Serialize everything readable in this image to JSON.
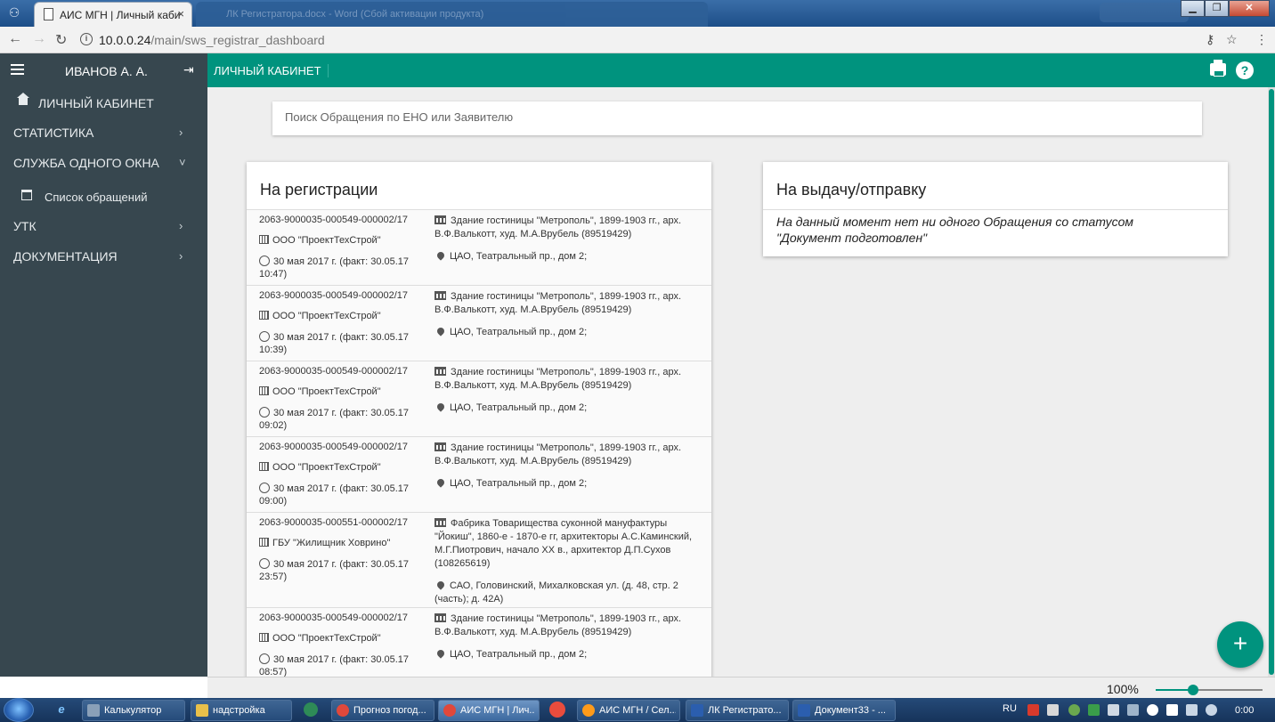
{
  "browser": {
    "active_tab_title": "АИС МГН | Личный каби",
    "tab_close": "×",
    "inactive_tab_title": "ЛК Регистратора.docx - Word (Сбой активации продукта)",
    "url_host": "10.0.0.24",
    "url_path": "/main/sws_registrar_dashboard",
    "info_icon": "i",
    "window_buttons": [
      "▁",
      "❐",
      "✕"
    ]
  },
  "header": {
    "username": "ИВАНОВ А. А.",
    "logout_icon": "⇥",
    "crumb": "ЛИЧНЫЙ КАБИНЕТ",
    "help_icon": "?",
    "accent": "#00937e",
    "sidebar_bg": "#37474f"
  },
  "sidebar": {
    "home": "ЛИЧНЫЙ КАБИНЕТ",
    "items": [
      {
        "label": "СТАТИСТИКА",
        "chevron": "›"
      },
      {
        "label": "СЛУЖБА ОДНОГО ОКНА",
        "chevron": "˅"
      },
      {
        "label": "УТК",
        "chevron": "›"
      },
      {
        "label": "ДОКУМЕНТАЦИЯ",
        "chevron": "›"
      }
    ],
    "sub_item": "Список обращений"
  },
  "search": {
    "placeholder": "Поиск Обращения по ЕНО или Заявителю"
  },
  "registration": {
    "title": "На регистрации",
    "rows": [
      {
        "eno": "2063-9000035-000549-000002/17",
        "org": "ООО \"ПроектТехСтрой\"",
        "date": "30 мая 2017 г. (факт: 30.05.17 10:47)",
        "object": "Здание гостиницы \"Метрополь\", 1899-1903 гг., арх. В.Ф.Валькотт, худ. М.А.Врубель (89519429)",
        "address": "ЦАО, Театральный пр., дом 2;"
      },
      {
        "eno": "2063-9000035-000549-000002/17",
        "org": "ООО \"ПроектТехСтрой\"",
        "date": "30 мая 2017 г. (факт: 30.05.17 10:39)",
        "object": "Здание гостиницы \"Метрополь\", 1899-1903 гг., арх. В.Ф.Валькотт, худ. М.А.Врубель (89519429)",
        "address": "ЦАО, Театральный пр., дом 2;"
      },
      {
        "eno": "2063-9000035-000549-000002/17",
        "org": "ООО \"ПроектТехСтрой\"",
        "date": "30 мая 2017 г. (факт: 30.05.17 09:02)",
        "object": "Здание гостиницы \"Метрополь\", 1899-1903 гг., арх. В.Ф.Валькотт, худ. М.А.Врубель (89519429)",
        "address": "ЦАО, Театральный пр., дом 2;"
      },
      {
        "eno": "2063-9000035-000549-000002/17",
        "org": "ООО \"ПроектТехСтрой\"",
        "date": "30 мая 2017 г. (факт: 30.05.17 09:00)",
        "object": "Здание гостиницы \"Метрополь\", 1899-1903 гг., арх. В.Ф.Валькотт, худ. М.А.Врубель (89519429)",
        "address": "ЦАО, Театральный пр., дом 2;"
      },
      {
        "eno": "2063-9000035-000551-000002/17",
        "org": "ГБУ \"Жилищник Ховрино\"",
        "date": "30 мая 2017 г. (факт: 30.05.17 23:57)",
        "object": "Фабрика Товарищества суконной мануфактуры \"Йокиш\", 1860-е - 1870-е гг, архитекторы А.С.Каминский, М.Г.Пиотрович, начало XX в., архитектор Д.П.Сухов (108265619)",
        "address": "САО, Головинский, Михалковская ул. (д. 48, стр. 2 (часть); д. 42А)"
      },
      {
        "eno": "2063-9000035-000549-000002/17",
        "org": "ООО \"ПроектТехСтрой\"",
        "date": "30 мая 2017 г. (факт: 30.05.17 08:57)",
        "object": "Здание гостиницы \"Метрополь\", 1899-1903 гг., арх. В.Ф.Валькотт, худ. М.А.Врубель (89519429)",
        "address": "ЦАО, Театральный пр., дом 2;"
      }
    ]
  },
  "outgoing": {
    "title": "На выдачу/отправку",
    "empty_message": "На данный момент нет ни одного Обращения со статусом \"Документ подготовлен\""
  },
  "fab_label": "+",
  "status": {
    "zoom": "100%",
    "zoom_level": 0.35
  },
  "taskbar": {
    "ie_icon": "e",
    "buttons": [
      "Калькулятор",
      "надстройка",
      "Прогноз погод...",
      "АИС МГН | Лич...",
      "АИС МГН / Сел...",
      "ЛК Регистрато...",
      "Документ33 - ..."
    ],
    "language": "RU",
    "time": "0:00"
  }
}
